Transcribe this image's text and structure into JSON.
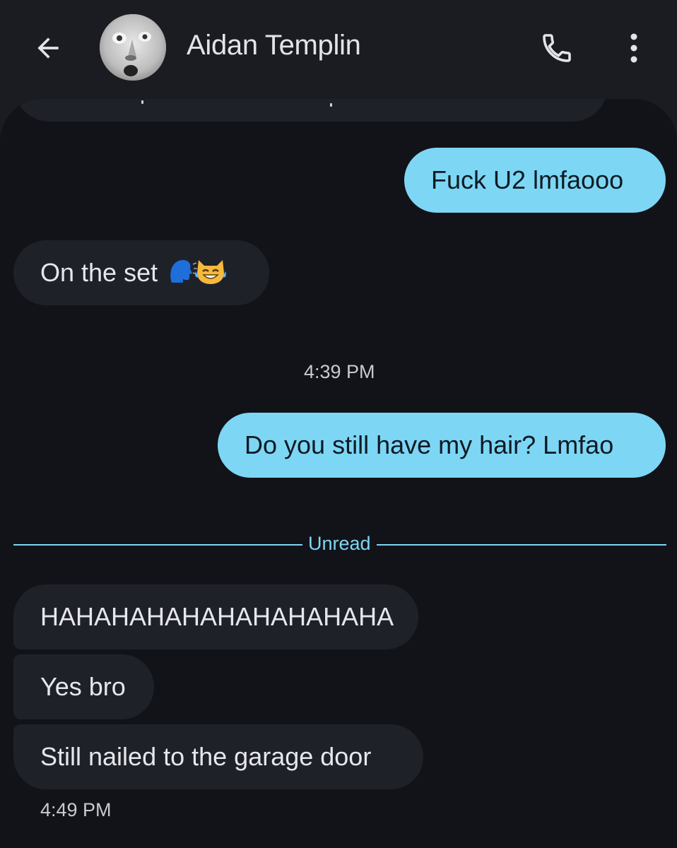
{
  "header": {
    "contact_name": "Aidan Templin",
    "back_icon": "arrow-left-icon",
    "call_icon": "phone-icon",
    "more_icon": "more-vert-icon",
    "avatar": "contact-avatar-photo"
  },
  "messages": [
    {
      "direction": "outgoing",
      "text": "Fuck U2 lmfaooo"
    },
    {
      "direction": "incoming",
      "text": "On the set",
      "emoji": [
        "speaking-head-emoji",
        "cat-tears-of-joy-emoji"
      ]
    },
    {
      "direction": "outgoing",
      "text": "Do you still have my hair? Lmfao"
    },
    {
      "direction": "incoming",
      "text": "HAHAHAHAHAHAHAHAHAHA"
    },
    {
      "direction": "incoming",
      "text": "Yes bro"
    },
    {
      "direction": "incoming",
      "text": "Still nailed to the garage door"
    }
  ],
  "timestamps": {
    "first": "4:39 PM",
    "last": "4:49 PM"
  },
  "unread_divider": {
    "label": "Unread"
  },
  "colors": {
    "background": "#121318",
    "header": "#1a1c22",
    "outgoing_bubble": "#7ed6f5",
    "incoming_bubble": "#1f2129",
    "accent": "#7ed6f5"
  }
}
